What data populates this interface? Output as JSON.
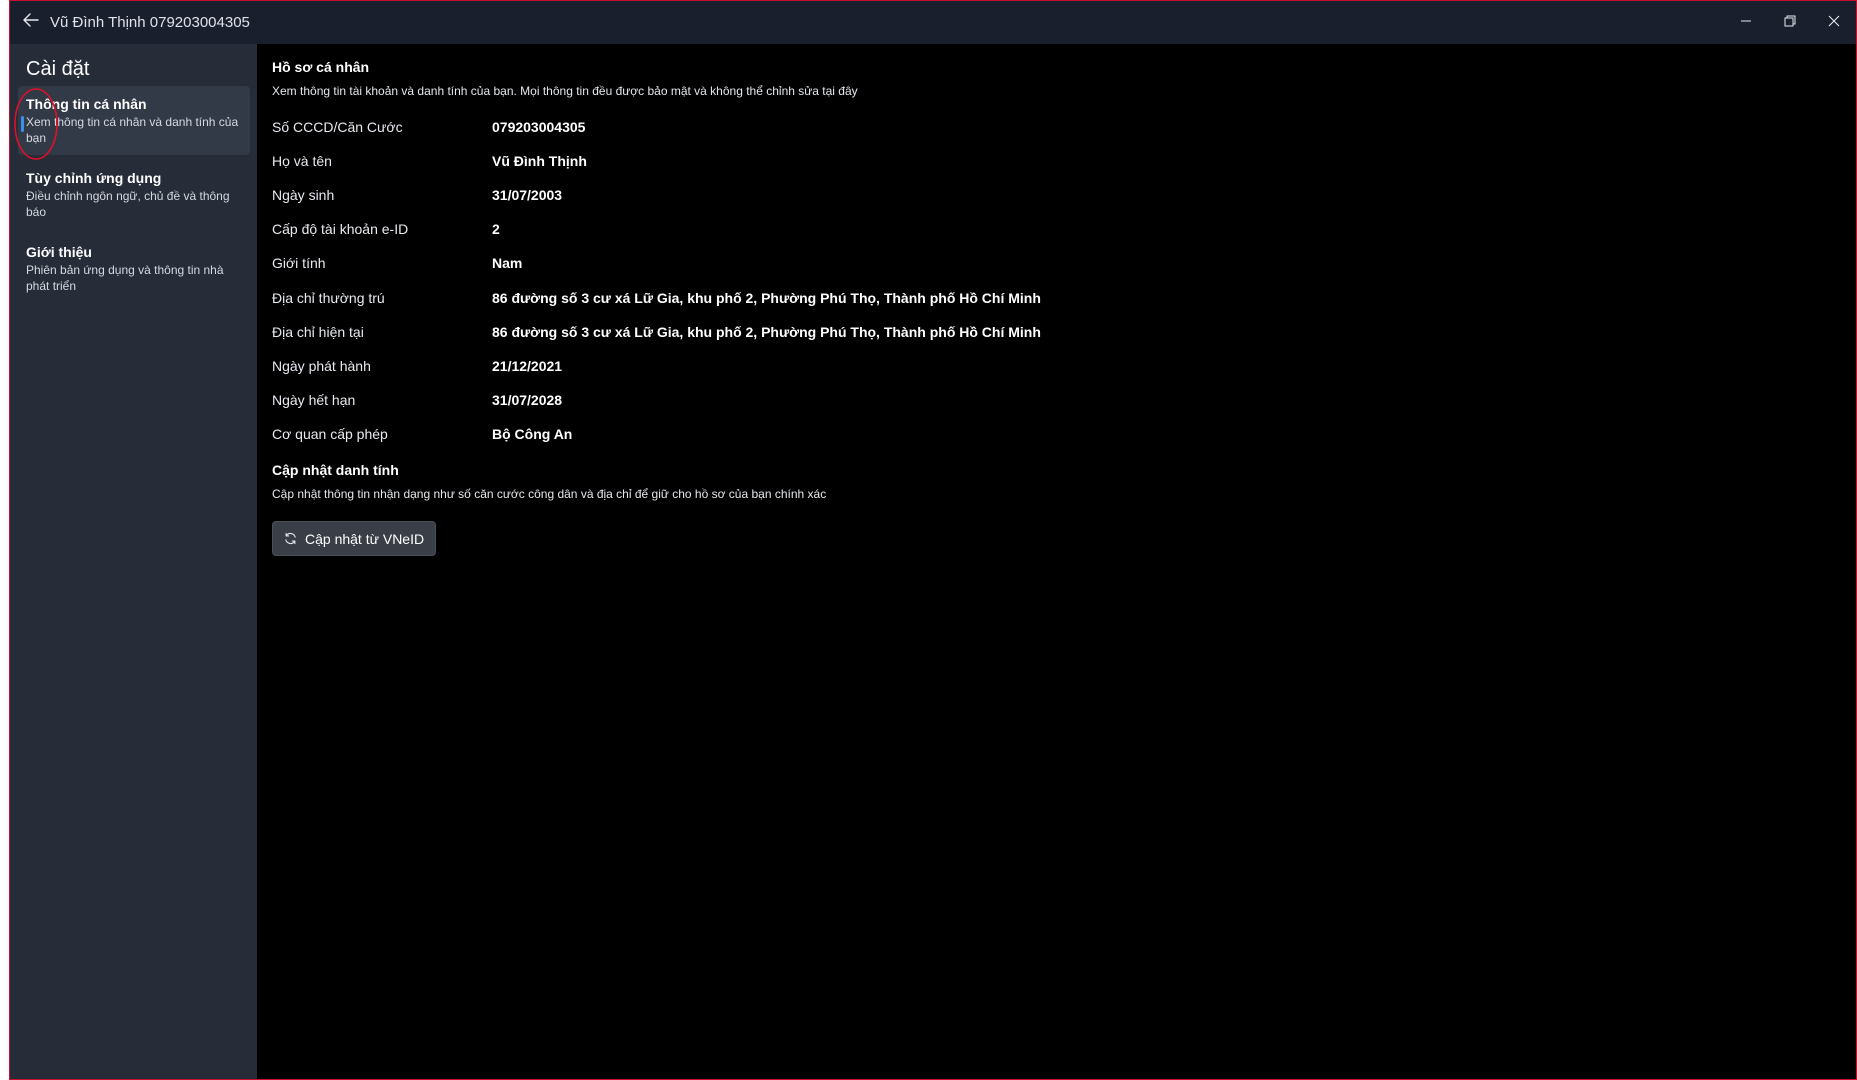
{
  "window": {
    "title": "Vũ Đình Thịnh 079203004305"
  },
  "sidebar": {
    "title": "Cài đặt",
    "items": [
      {
        "label": "Thông tin cá nhân",
        "desc": "Xem thông tin cá nhân và danh tính của bạn",
        "active": true
      },
      {
        "label": "Tùy chỉnh ứng dụng",
        "desc": "Điều chỉnh ngôn ngữ, chủ đề và thông báo",
        "active": false
      },
      {
        "label": "Giới thiệu",
        "desc": "Phiên bản ứng dụng và thông tin nhà phát triển",
        "active": false
      }
    ]
  },
  "profile": {
    "title": "Hồ sơ cá nhân",
    "desc": "Xem thông tin tài khoản và danh tính của bạn. Mọi thông tin đều được bảo mật và không thể chỉnh sửa tại đây",
    "fields": [
      {
        "label": "Số CCCD/Căn Cước",
        "value": "079203004305"
      },
      {
        "label": "Họ và tên",
        "value": "Vũ Đình Thịnh"
      },
      {
        "label": "Ngày sinh",
        "value": "31/07/2003"
      },
      {
        "label": "Cấp độ tài khoản e-ID",
        "value": "2"
      },
      {
        "label": "Giới tính",
        "value": "Nam"
      },
      {
        "label": "Địa chỉ thường trú",
        "value": "86 đường số 3 cư xá Lữ Gia, khu phố 2, Phường Phú Thọ, Thành phố Hồ Chí Minh"
      },
      {
        "label": "Địa chỉ hiện tại",
        "value": "86 đường số 3 cư xá Lữ Gia, khu phố 2, Phường Phú Thọ, Thành phố Hồ Chí Minh"
      },
      {
        "label": "Ngày phát hành",
        "value": "21/12/2021"
      },
      {
        "label": "Ngày hết hạn",
        "value": "31/07/2028"
      },
      {
        "label": "Cơ quan cấp phép",
        "value": "Bộ Công An"
      }
    ]
  },
  "identity_update": {
    "title": "Cập nhật danh tính",
    "desc": "Cập nhật thông tin nhận dạng như số căn cước công dân và địa chỉ để giữ cho hồ sơ của bạn chính xác",
    "button_label": "Cập nhật từ VNeID",
    "button_icon": "refresh-icon"
  },
  "colors": {
    "titlebar": "#1a1f2e",
    "sidebar": "#262c38",
    "sidebar_active": "#333a47",
    "accent": "#3b8eea",
    "content_bg": "#000000",
    "window_border": "#c8102e",
    "annotation": "#e0102a"
  },
  "icons": {
    "back": "arrow-left-icon",
    "minimize": "minimize-icon",
    "restore": "restore-icon",
    "close": "close-icon"
  }
}
